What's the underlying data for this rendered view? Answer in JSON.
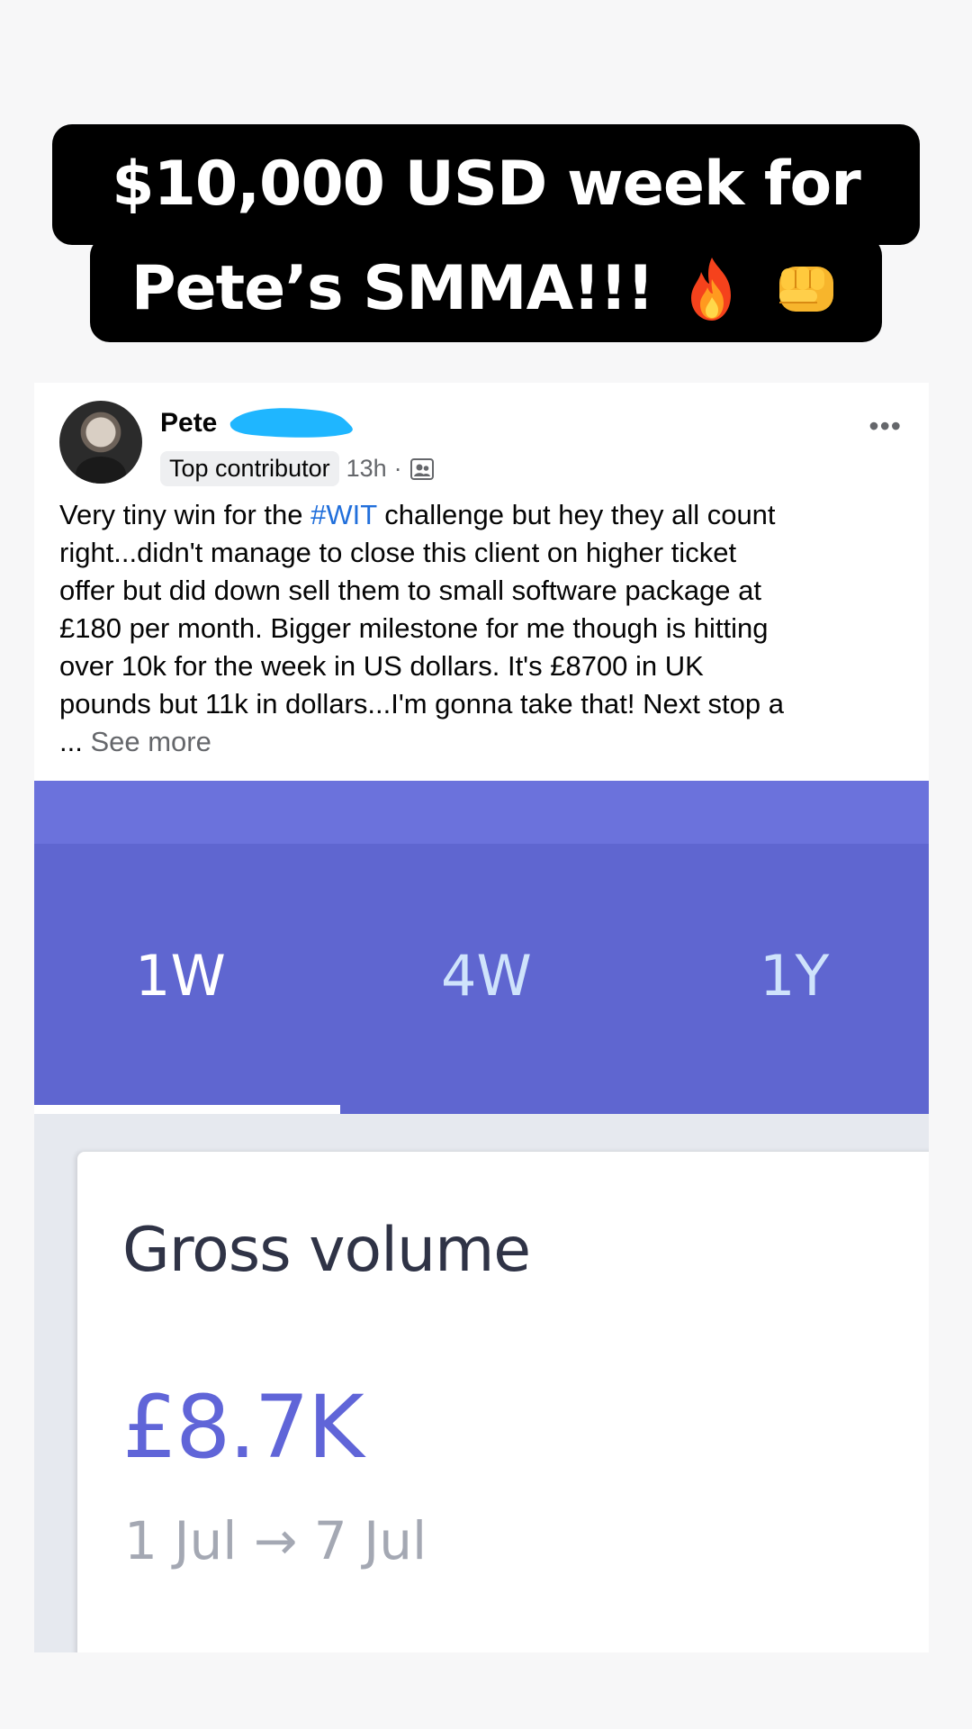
{
  "caption": {
    "line1": "$10,000 USD week for",
    "line2": "Pete’s SMMA!!!",
    "emojis": [
      "fire-emoji",
      "oncoming-fist-emoji"
    ]
  },
  "post": {
    "author": "Pete",
    "badge": "Top contributor",
    "time": "13h",
    "separator": "·",
    "audience_icon": "group-icon",
    "more_icon": "•••",
    "text": {
      "line1_before": "Very tiny win for the ",
      "hashtag": "#WIT",
      "line1_after": " challenge but hey they all count",
      "line2": "right...didn't manage to close this client on higher ticket",
      "line3": "offer but did down sell them to small software package at",
      "line4": "£180 per month. Bigger milestone for me though is hitting",
      "line5": "over 10k for the week in US dollars. It's £8700 in UK",
      "line6": "pounds but 11k in dollars...I'm gonna take that! Next stop a",
      "ellipsis": "... ",
      "see_more": "See more"
    }
  },
  "screenshot": {
    "tabs": [
      "1W",
      "4W",
      "1Y"
    ],
    "active_tab": "1W",
    "card": {
      "title": "Gross volume",
      "value": "£8.7K",
      "range": "1 Jul → 7 Jul"
    }
  },
  "colors": {
    "tab_bar": "#5f66d0",
    "top_bar": "#6b72dc",
    "value": "#6065d8",
    "hashtag": "#216fdb",
    "redaction": "#1fb6ff"
  }
}
